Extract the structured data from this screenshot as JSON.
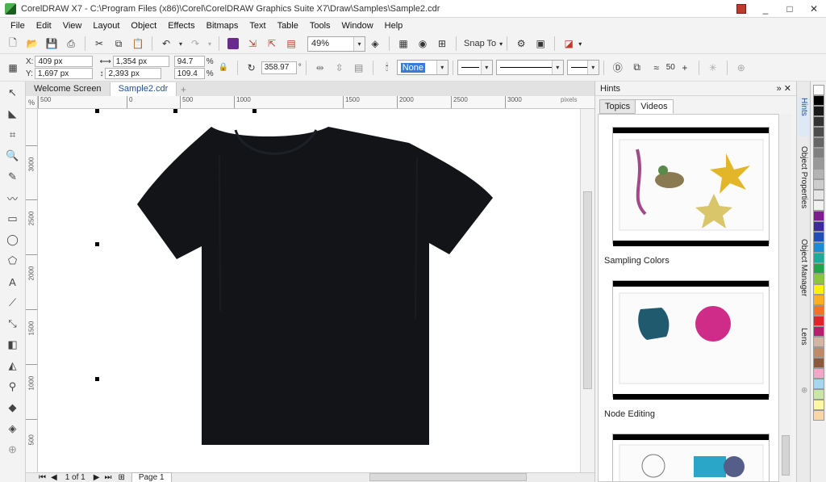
{
  "window": {
    "title": "CorelDRAW X7 - C:\\Program Files (x86)\\Corel\\CorelDRAW Graphics Suite X7\\Draw\\Samples\\Sample2.cdr",
    "controls": [
      "_",
      "□",
      "✕"
    ]
  },
  "menu": [
    "File",
    "Edit",
    "View",
    "Layout",
    "Object",
    "Effects",
    "Bitmaps",
    "Text",
    "Table",
    "Tools",
    "Window",
    "Help"
  ],
  "standard_toolbar": {
    "zoom_value": "49%",
    "snap_to_label": "Snap To"
  },
  "property_bar": {
    "x_label": "X:",
    "x_value": "409 px",
    "y_label": "Y:",
    "y_value": "1,697 px",
    "width_value": "1,354 px",
    "height_value": "2,393 px",
    "scale_x": "94.7",
    "scale_y": "109.4",
    "percent": "%",
    "rotation": "358.97",
    "degree": "°",
    "fill_value": "None",
    "spin_value": "50"
  },
  "document_tabs": [
    {
      "label": "Welcome Screen",
      "active": false
    },
    {
      "label": "Sample2.cdr",
      "active": true
    }
  ],
  "ruler": {
    "corner": "%",
    "units": "pixels",
    "h_ticks": [
      "500",
      "0",
      "500",
      "1000",
      "1500",
      "2000",
      "2500",
      "3000",
      "3500"
    ],
    "v_ticks": [
      "3000",
      "2500",
      "2000",
      "1500",
      "1000",
      "500"
    ]
  },
  "status": {
    "page_position": "1 of 1",
    "page_tab": "Page 1"
  },
  "hints": {
    "title": "Hints",
    "tabs": [
      "Topics",
      "Videos"
    ],
    "active_tab": "Videos",
    "video_captions": [
      "Sampling Colors",
      "Node Editing"
    ]
  },
  "side_tabs": [
    "Hints",
    "Object Properties",
    "Object Manager",
    "Lens"
  ],
  "palette_colors": [
    "#ffffff",
    "#000000",
    "#1a1a1a",
    "#333333",
    "#4d4d4d",
    "#666666",
    "#808080",
    "#999999",
    "#b3b3b3",
    "#cccccc",
    "#e6e6e6",
    "#f2f2f2",
    "#7a1f8c",
    "#3d2b9a",
    "#1f4fb5",
    "#1c8bd6",
    "#1fa99a",
    "#23a34a",
    "#8cc63f",
    "#fff200",
    "#f7b21b",
    "#f0722b",
    "#e3222b",
    "#b51f6e",
    "#d4b5a3",
    "#c08a6a",
    "#8b5a3c",
    "#f4a6c8",
    "#a6d6ef",
    "#c8e6a6",
    "#fff7a6",
    "#f9d6a6"
  ]
}
